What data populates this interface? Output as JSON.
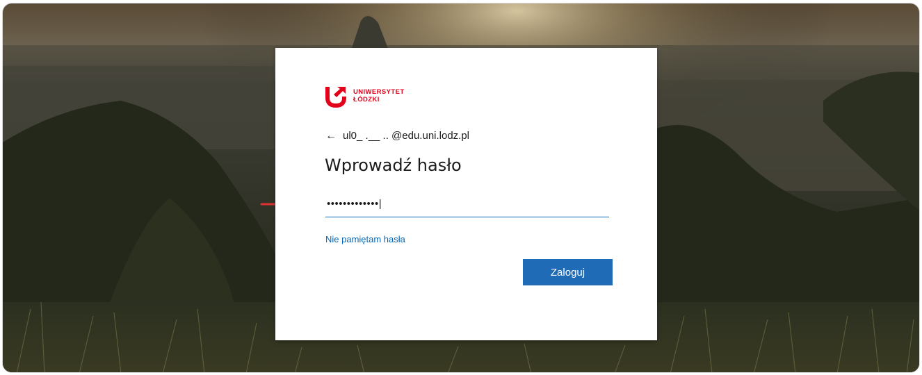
{
  "brand": {
    "line1": "UNIWERSYTET",
    "line2": "ŁÓDZKI",
    "accent_color": "#e3001b"
  },
  "identity": {
    "back_icon": "back-arrow-icon",
    "back_glyph": "←",
    "account": "ul0_ .__ .. @edu.uni.lodz.pl"
  },
  "signin": {
    "heading": "Wprowadź hasło",
    "password_value": "•••••••••••••|",
    "forgot_label": "Nie pamiętam hasła",
    "submit_label": "Zaloguj",
    "link_color": "#0067b8",
    "button_color": "#1f6bb6"
  },
  "annotation": {
    "icon": "red-arrow-icon",
    "color": "#e03030"
  }
}
